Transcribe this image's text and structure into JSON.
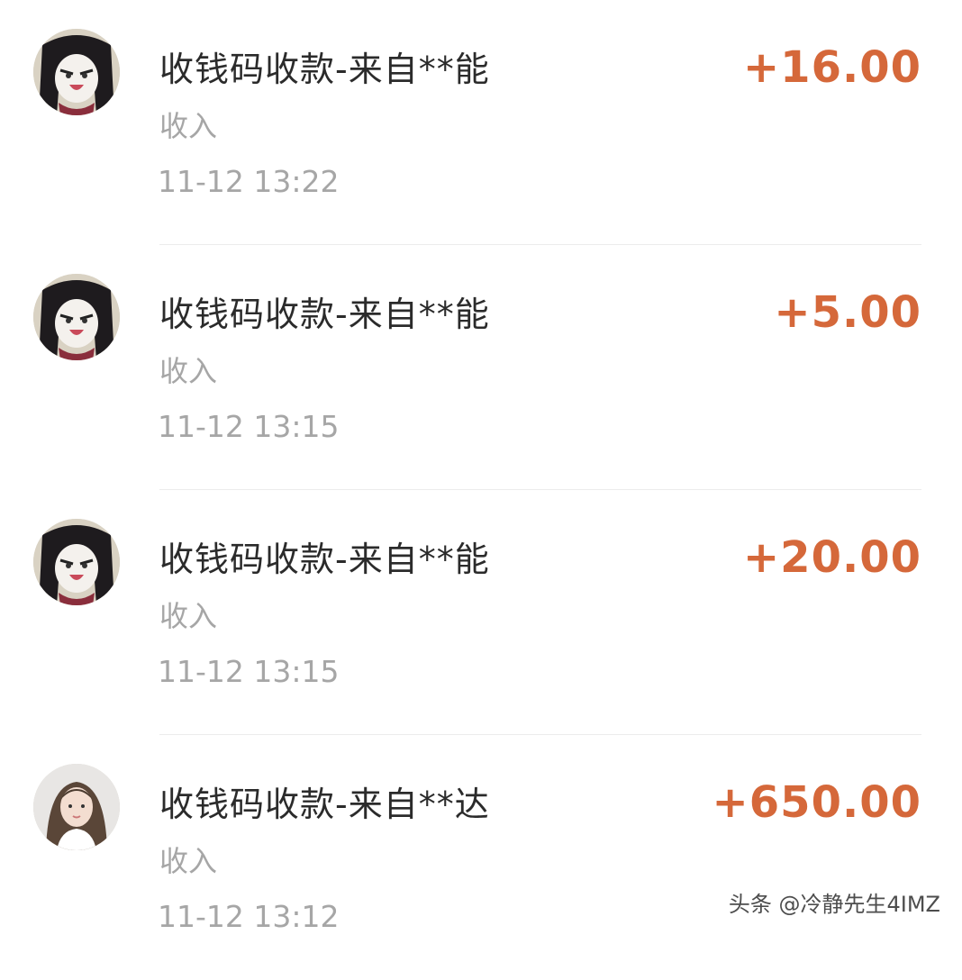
{
  "transactions": [
    {
      "avatar": "cartoon-face-avatar",
      "title": "收钱码收款-来自**能",
      "type": "收入",
      "time": "11-12  13:22",
      "amount": "+16.00"
    },
    {
      "avatar": "cartoon-face-avatar",
      "title": "收钱码收款-来自**能",
      "type": "收入",
      "time": "11-12  13:15",
      "amount": "+5.00"
    },
    {
      "avatar": "cartoon-face-avatar",
      "title": "收钱码收款-来自**能",
      "type": "收入",
      "time": "11-12  13:15",
      "amount": "+20.00"
    },
    {
      "avatar": "portrait-photo-avatar",
      "title": "收钱码收款-来自**达",
      "type": "收入",
      "time": "11-12  13:12",
      "amount": "+650.00"
    }
  ],
  "watermark": "头条 @冷静先生4IMZ",
  "colors": {
    "amount": "#d5683a",
    "title": "#2b2b2b",
    "secondary": "#a6a6a6",
    "divider": "#ececec"
  }
}
